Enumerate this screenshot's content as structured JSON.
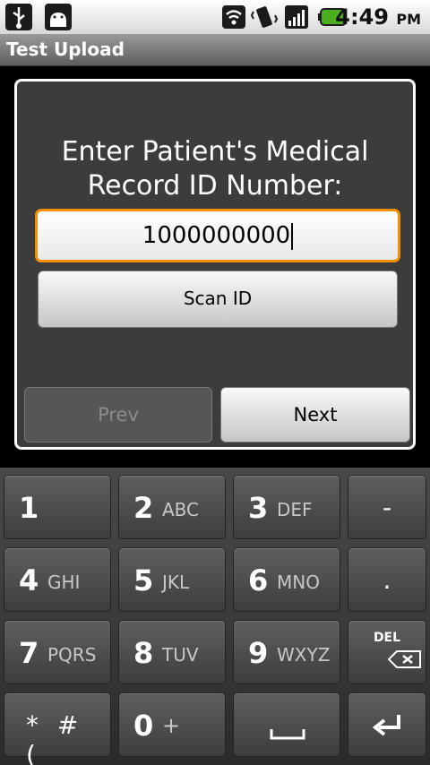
{
  "status_bar": {
    "time": "4:49",
    "ampm": "PM",
    "icons": [
      "usb-icon",
      "android-debug-icon",
      "wifi-icon",
      "vibrate-icon",
      "signal-icon",
      "battery-icon"
    ]
  },
  "title_bar": {
    "title": "Test Upload"
  },
  "form": {
    "prompt_line1": "Enter Patient's Medical",
    "prompt_line2": "Record ID Number:",
    "id_value": "1000000000",
    "scan_label": "Scan ID",
    "prev_label": "Prev",
    "next_label": "Next"
  },
  "keyboard": {
    "keys": [
      {
        "num": "1",
        "letters": ""
      },
      {
        "num": "2",
        "letters": "ABC"
      },
      {
        "num": "3",
        "letters": "DEF"
      },
      {
        "center": "-"
      },
      {
        "num": "4",
        "letters": "GHI"
      },
      {
        "num": "5",
        "letters": "JKL"
      },
      {
        "num": "6",
        "letters": "MNO"
      },
      {
        "center": "."
      },
      {
        "num": "7",
        "letters": "PQRS"
      },
      {
        "num": "8",
        "letters": "TUV"
      },
      {
        "num": "9",
        "letters": "WXYZ"
      },
      {
        "del": "DEL"
      },
      {
        "sym": "* # ("
      },
      {
        "num": "0",
        "letters": "+"
      },
      {
        "center": "␣"
      },
      {
        "center": "↵"
      }
    ]
  },
  "colors": {
    "focus_border": "#f58f00",
    "panel_bg": "#3c3c3c",
    "battery": "#4caf1f"
  }
}
